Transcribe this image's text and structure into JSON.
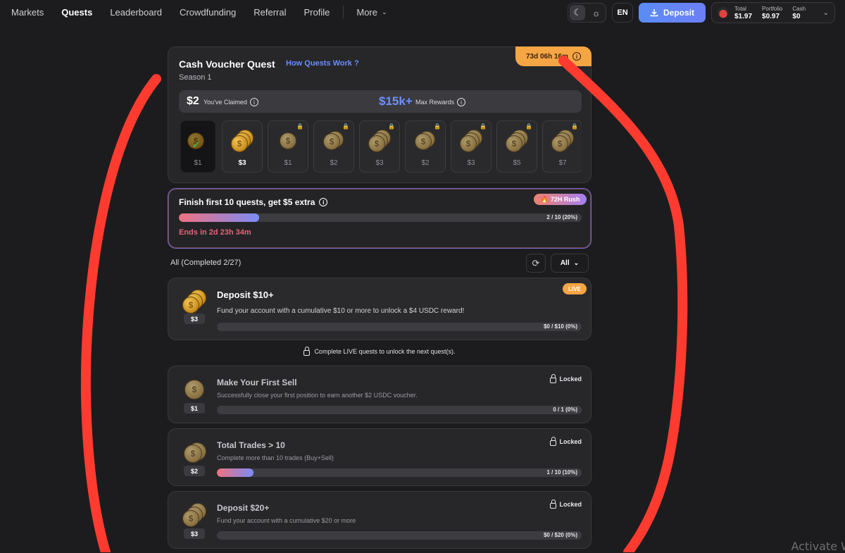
{
  "nav": {
    "items": [
      "Markets",
      "Quests",
      "Leaderboard",
      "Crowdfunding",
      "Referral",
      "Profile"
    ],
    "more_label": "More"
  },
  "topbar": {
    "lang": "EN",
    "deposit_label": "Deposit",
    "account": {
      "total_label": "Total",
      "total_value": "$1.97",
      "portfolio_label": "Portfolio",
      "portfolio_value": "$0.97",
      "cash_label": "Cash",
      "cash_value": "$0"
    }
  },
  "quest_header": {
    "title": "Cash Voucher Quest",
    "link": "How Quests Work ?",
    "season": "Season 1",
    "timer": "73d 06h 16m",
    "claimed_amount": "$2",
    "claimed_label": "You've Claimed",
    "max_amount": "$15k+",
    "max_label": "Max Rewards",
    "rewards": [
      "$1",
      "$3",
      "$1",
      "$2",
      "$3",
      "$2",
      "$3",
      "$5",
      "$7"
    ]
  },
  "rush": {
    "title": "Finish first 10 quests, get $5 extra",
    "badge": "72H Rush",
    "progress_text": "2 / 10  (20%)",
    "progress": 0.2,
    "ends": "Ends in 2d 23h 34m"
  },
  "filter": {
    "label": "All (Completed 2/27)",
    "select": "All"
  },
  "notice": "Complete LIVE quests to unlock the next quest(s).",
  "quests": [
    {
      "title": "Deposit $10+",
      "desc": "Fund your account with a cumulative $10 or more to unlock a $4 USDC reward!",
      "reward": "$3",
      "progress_text": "$0 / $10  (0%)",
      "progress": 0,
      "badge": "LIVE"
    },
    {
      "title": "Make Your First Sell",
      "desc": "Successfully close your first position to earn another $2 USDC voucher.",
      "reward": "$1",
      "progress_text": "0 / 1  (0%)",
      "progress": 0,
      "badge": "Locked"
    },
    {
      "title": "Total Trades > 10",
      "desc": "Complete more than 10 trades (Buy+Sell)",
      "reward": "$2",
      "progress_text": "1 / 10  (10%)",
      "progress": 0.1,
      "badge": "Locked"
    },
    {
      "title": "Deposit $20+",
      "desc": "Fund your account with a cumulative $20 or more",
      "reward": "$3",
      "progress_text": "$0 / $20  (0%)",
      "progress": 0,
      "badge": "Locked"
    }
  ],
  "watermark": "Activate W",
  "colors": {
    "accent": "#6a8cff",
    "timer": "#f6a544",
    "annotation": "#ff3b30"
  }
}
